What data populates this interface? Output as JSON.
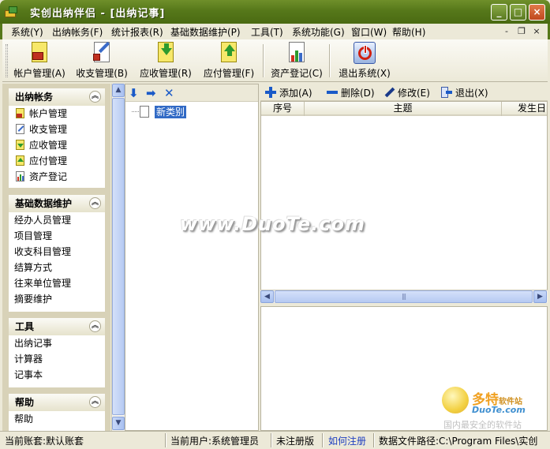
{
  "window": {
    "title": "实创出纳伴侣 - [出纳记事]",
    "minimize": "_",
    "maximize": "□",
    "close": "×"
  },
  "menu": [
    {
      "label": "系统(Y)"
    },
    {
      "label": "出纳帐务(F)"
    },
    {
      "label": "统计报表(R)"
    },
    {
      "label": "基础数据维护(P)"
    },
    {
      "label": "工具(T)"
    },
    {
      "label": "系统功能(G)"
    },
    {
      "label": "窗口(W)"
    },
    {
      "label": "帮助(H)"
    }
  ],
  "mdi_controls": {
    "minimize": "-",
    "restore": "❐",
    "close": "×"
  },
  "toolbar": [
    {
      "label": "帐户管理(A)",
      "icon": "account-book-icon"
    },
    {
      "label": "收支管理(B)",
      "icon": "income-expense-icon"
    },
    {
      "label": "应收管理(R)",
      "icon": "receivable-icon"
    },
    {
      "label": "应付管理(F)",
      "icon": "payable-icon"
    },
    {
      "label": "资产登记(C)",
      "icon": "asset-chart-icon"
    },
    {
      "label": "退出系统(X)",
      "icon": "power-icon"
    }
  ],
  "nav": {
    "collapse_glyph": "︽",
    "groups": [
      {
        "title": "出纳帐务",
        "items": [
          "帐户管理",
          "收支管理",
          "应收管理",
          "应付管理",
          "资产登记"
        ]
      },
      {
        "title": "基础数据维护",
        "items": [
          "经办人员管理",
          "项目管理",
          "收支科目管理",
          "结算方式",
          "往来单位管理",
          "摘要维护"
        ]
      },
      {
        "title": "工具",
        "items": [
          "出纳记事",
          "计算器",
          "记事本"
        ]
      },
      {
        "title": "帮助",
        "items": [
          "帮助"
        ]
      }
    ]
  },
  "tree": {
    "toolbar_glyphs": {
      "down": "⬇",
      "right": "➡",
      "delete": "✕"
    },
    "nodes": [
      {
        "label": "新类别"
      }
    ]
  },
  "right_toolbar": [
    {
      "label": "添加(A)",
      "icon": "add-icon"
    },
    {
      "label": "删除(D)",
      "icon": "delete-icon"
    },
    {
      "label": "修改(E)",
      "icon": "edit-icon"
    },
    {
      "label": "退出(X)",
      "icon": "exit-icon"
    }
  ],
  "grid": {
    "columns": [
      "序号",
      "主题",
      "发生日"
    ],
    "rows": []
  },
  "scroll_glyphs": {
    "up": "▲",
    "down": "▼",
    "left": "◀",
    "right": "▶",
    "grip": "|||"
  },
  "statusbar": {
    "account": "当前账套:默认账套",
    "user": "当前用户:系统管理员",
    "edition": "未注册版",
    "register_link": "如何注册",
    "path": "数据文件路径:C:\\Program Files\\实创"
  },
  "watermarks": {
    "center": "www.DuoTe.com",
    "logo_title": "多特",
    "logo_suffix": "软件站",
    "logo_url": "DuoTe.com",
    "logo_slogan": "国内最安全的软件站"
  },
  "colors": {
    "title_bar": "#56781a",
    "selection": "#316ac5",
    "link": "#2040c0"
  }
}
